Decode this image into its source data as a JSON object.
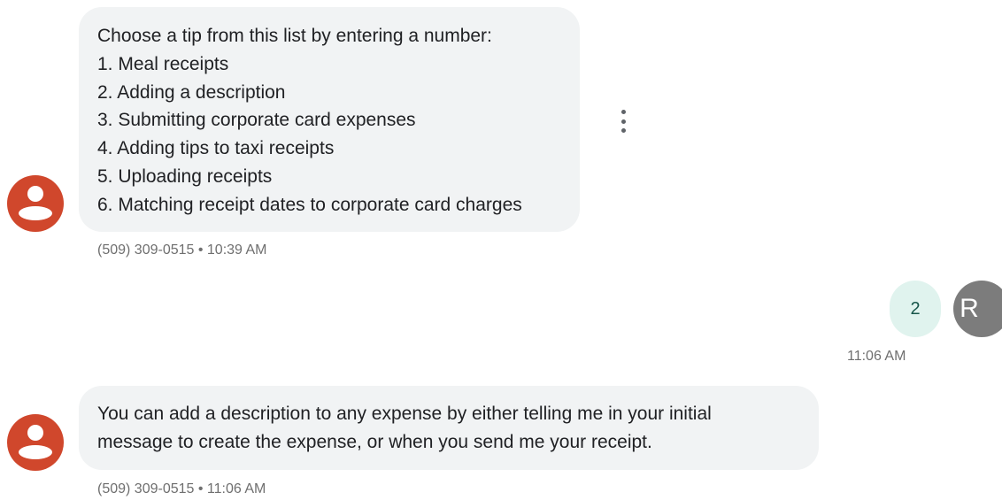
{
  "conversation": {
    "messages": [
      {
        "direction": "incoming",
        "lines": [
          "Choose a tip from this list by entering a number:",
          "1. Meal receipts",
          "2. Adding a description",
          "3. Submitting corporate card expenses",
          "4. Adding tips to taxi receipts",
          "5. Uploading receipts",
          "6. Matching receipt dates to corporate card charges"
        ],
        "meta": "(509) 309-0515 • 10:39 AM"
      },
      {
        "direction": "outgoing",
        "text": "2",
        "avatar_initial": "R",
        "meta": "11:06 AM"
      },
      {
        "direction": "incoming",
        "lines": [
          "You can add a description to any expense by either telling me in your initial",
          "message to create the expense, or when you send me your receipt."
        ],
        "meta": "(509) 309-0515 • 11:06 AM"
      }
    ]
  },
  "colors": {
    "contact_avatar": "#d0472c",
    "incoming_bubble": "#f1f3f4",
    "outgoing_bubble": "#e0f3ee",
    "user_avatar": "#7c7c7c"
  },
  "icons": {
    "contact_avatar": "person-icon",
    "message_options": "more-vert-icon"
  }
}
